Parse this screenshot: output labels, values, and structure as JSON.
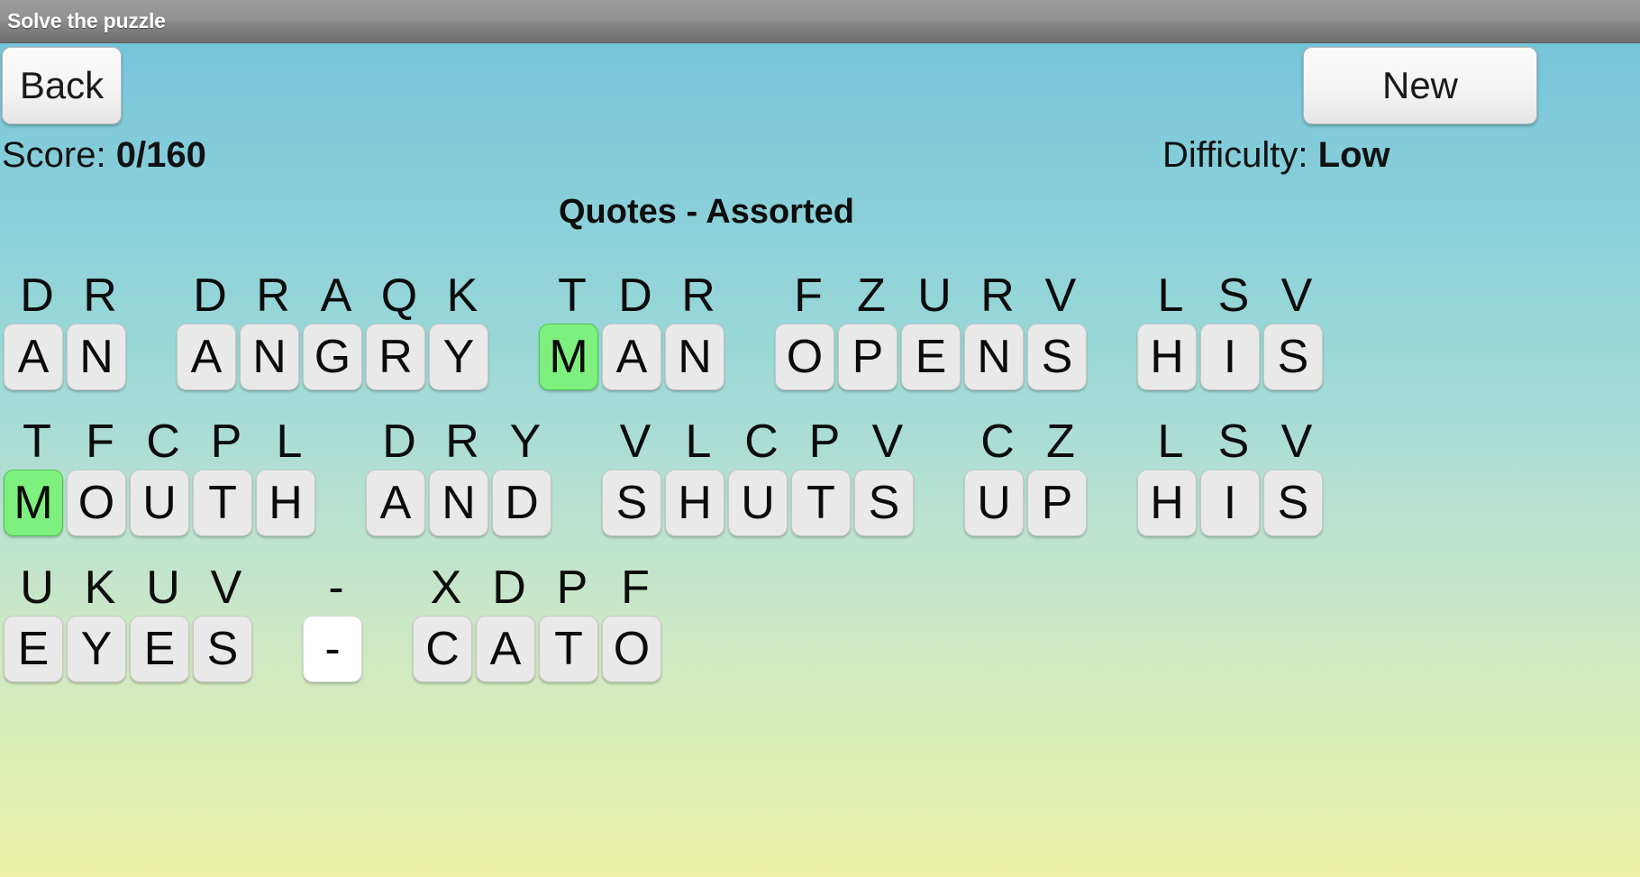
{
  "window": {
    "title": "Solve the puzzle"
  },
  "toolbar": {
    "back_label": "Back",
    "new_label": "New"
  },
  "status": {
    "score_label": "Score: ",
    "score_value": "0/160",
    "difficulty_label": "Difficulty: ",
    "difficulty_value": "Low"
  },
  "puzzle": {
    "title": "Quotes - Assorted",
    "selected_letter": "M",
    "colors": {
      "selected_tile": "#7ef07e",
      "tile": "#e9e9e9",
      "punct_tile": "#ffffff",
      "titlebar": "#8b8b8b",
      "text": "#0b0b0b"
    },
    "rows": [
      {
        "words": [
          {
            "cipher": [
              "D",
              "R"
            ],
            "answer": [
              "A",
              "N"
            ],
            "selected": [
              false,
              false
            ]
          },
          {
            "cipher": [
              "D",
              "R",
              "A",
              "Q",
              "K"
            ],
            "answer": [
              "A",
              "N",
              "G",
              "R",
              "Y"
            ],
            "selected": [
              false,
              false,
              false,
              false,
              false
            ]
          },
          {
            "cipher": [
              "T",
              "D",
              "R"
            ],
            "answer": [
              "M",
              "A",
              "N"
            ],
            "selected": [
              true,
              false,
              false
            ]
          },
          {
            "cipher": [
              "F",
              "Z",
              "U",
              "R",
              "V"
            ],
            "answer": [
              "O",
              "P",
              "E",
              "N",
              "S"
            ],
            "selected": [
              false,
              false,
              false,
              false,
              false
            ]
          },
          {
            "cipher": [
              "L",
              "S",
              "V"
            ],
            "answer": [
              "H",
              "I",
              "S"
            ],
            "selected": [
              false,
              false,
              false
            ]
          }
        ]
      },
      {
        "words": [
          {
            "cipher": [
              "T",
              "F",
              "C",
              "P",
              "L"
            ],
            "answer": [
              "M",
              "O",
              "U",
              "T",
              "H"
            ],
            "selected": [
              true,
              false,
              false,
              false,
              false
            ]
          },
          {
            "cipher": [
              "D",
              "R",
              "Y"
            ],
            "answer": [
              "A",
              "N",
              "D"
            ],
            "selected": [
              false,
              false,
              false
            ]
          },
          {
            "cipher": [
              "V",
              "L",
              "C",
              "P",
              "V"
            ],
            "answer": [
              "S",
              "H",
              "U",
              "T",
              "S"
            ],
            "selected": [
              false,
              false,
              false,
              false,
              false
            ]
          },
          {
            "cipher": [
              "C",
              "Z"
            ],
            "answer": [
              "U",
              "P"
            ],
            "selected": [
              false,
              false
            ]
          },
          {
            "cipher": [
              "L",
              "S",
              "V"
            ],
            "answer": [
              "H",
              "I",
              "S"
            ],
            "selected": [
              false,
              false,
              false
            ]
          }
        ]
      },
      {
        "words": [
          {
            "cipher": [
              "U",
              "K",
              "U",
              "V"
            ],
            "answer": [
              "E",
              "Y",
              "E",
              "S"
            ],
            "selected": [
              false,
              false,
              false,
              false
            ]
          },
          {
            "cipher": [
              "-"
            ],
            "answer": [
              "-"
            ],
            "selected": [
              false
            ],
            "punct": [
              true
            ]
          },
          {
            "cipher": [
              "X",
              "D",
              "P",
              "F"
            ],
            "answer": [
              "C",
              "A",
              "T",
              "O"
            ],
            "selected": [
              false,
              false,
              false,
              false
            ]
          }
        ]
      }
    ]
  }
}
